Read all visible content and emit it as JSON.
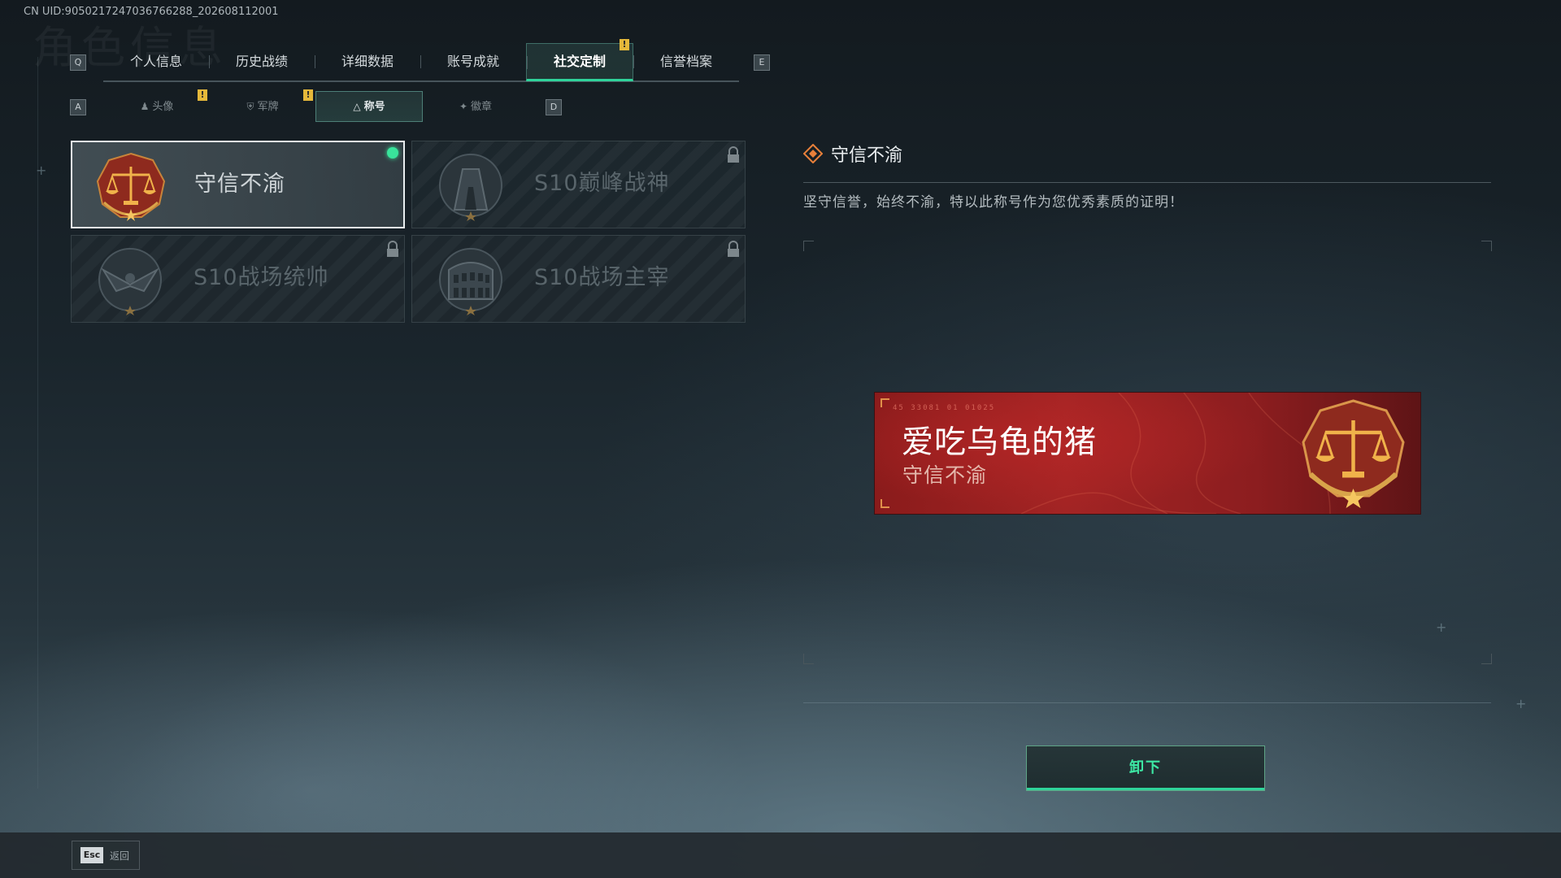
{
  "uid": "CN UID:9050217247036766288_202608112001",
  "bg_title": "角色信息",
  "top_tabs": {
    "key_left": "Q",
    "key_right": "E",
    "items": [
      {
        "label": "个人信息"
      },
      {
        "label": "历史战绩"
      },
      {
        "label": "详细数据"
      },
      {
        "label": "账号成就"
      },
      {
        "label": "社交定制"
      },
      {
        "label": "信誉档案"
      }
    ],
    "warn": "!"
  },
  "sub_tabs": {
    "key_left": "A",
    "key_right": "D",
    "items": [
      {
        "label": "头像"
      },
      {
        "label": "军牌"
      },
      {
        "label": "称号"
      },
      {
        "label": "徽章"
      }
    ]
  },
  "titles": [
    {
      "name": "守信不渝",
      "state": "equipped"
    },
    {
      "name": "S10巅峰战神",
      "state": "locked"
    },
    {
      "name": "S10战场统帅",
      "state": "locked"
    },
    {
      "name": "S10战场主宰",
      "state": "locked"
    }
  ],
  "detail": {
    "title": "守信不渝",
    "description": "坚守信誉，始终不渝，特以此称号作为您优秀素质的证明！"
  },
  "preview": {
    "code": "45 33081  01 01025",
    "player_name": "爱吃乌龟的猪",
    "title": "守信不渝"
  },
  "action_button": "卸下",
  "footer": {
    "esc_key": "Esc",
    "esc_label": "返回"
  },
  "colors": {
    "accent_green": "#2fd39a",
    "warn_yellow": "#e5b83a",
    "banner_red": "#a32424"
  }
}
